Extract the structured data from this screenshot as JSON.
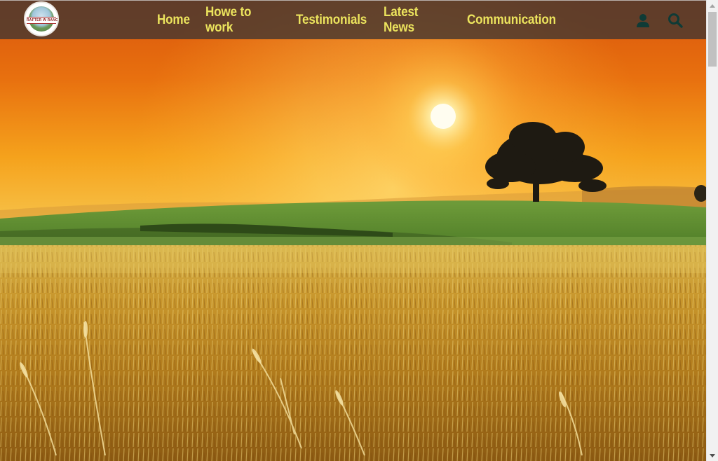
{
  "site": {
    "logo_text": "RAFTER W RANCH",
    "logo_alt": "ranch-logo"
  },
  "nav": {
    "items": [
      {
        "label": "Home"
      },
      {
        "label": "Howe to work"
      },
      {
        "label": "Testimonials"
      },
      {
        "label": "Latest News"
      },
      {
        "label": "Communication"
      }
    ],
    "link_color": "#ece45d",
    "bar_color": "#463730",
    "icons": {
      "account": "user-icon",
      "search": "search-icon",
      "icon_color": "#0f3b36"
    }
  },
  "hero": {
    "scene": "sunset over a wheat field with a lone tree on a green hill"
  },
  "scrollbar": {
    "position_percent": 0
  }
}
